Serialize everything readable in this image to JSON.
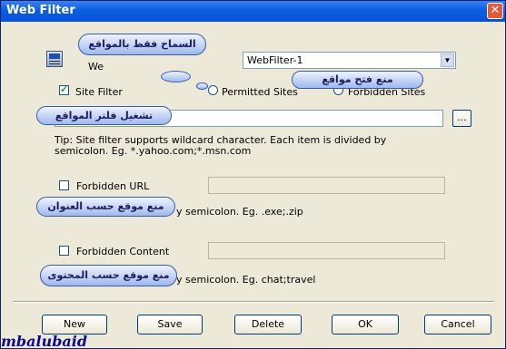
{
  "window": {
    "title": "Web Filter",
    "close_glyph": "✕"
  },
  "profile": {
    "label": "We",
    "value": "WebFilter-1",
    "arrow": "▼"
  },
  "site_filter": {
    "label": "Site Filter",
    "checked": true,
    "permitted_label": "Permitted Sites",
    "forbidden_label": "Forbidden Sites",
    "input_value": "",
    "browse_label": "...",
    "tip_line1": "Tip: Site filter supports wildcard character. Each item is divided by",
    "tip_line2": "semicolon. Eg. *.yahoo.com;*.msn.com"
  },
  "forbidden_url": {
    "label": "Forbidden URL",
    "checked": false,
    "input_value": "",
    "tip": "y semicolon. Eg. .exe;.zip"
  },
  "forbidden_content": {
    "label": "Forbidden Content",
    "checked": false,
    "input_value": "",
    "tip": "y semicolon. Eg. chat;travel"
  },
  "buttons": {
    "new": "New",
    "save": "Save",
    "delete": "Delete",
    "ok": "OK",
    "cancel": "Cancel"
  },
  "annotations": {
    "allow_sites_only": "السماح فقط بالمواقع",
    "block_opening_sites": "منع فتح مواقع",
    "enable_site_filter": "تشغيل فلتر المواقع",
    "block_by_address": "منع موقع حسب العنوان",
    "block_by_content": "منع موقع حسب المحتوى"
  },
  "watermark": "mbalubaid",
  "icons": {
    "profile": "profile-icon",
    "check": "check-icon",
    "dropdown": "chevron-down-icon"
  },
  "colors": {
    "titlebar": "#0a5ee0",
    "dialog": "#ece9d8",
    "bubble": "#9fb8ec",
    "close": "#e2593b"
  }
}
